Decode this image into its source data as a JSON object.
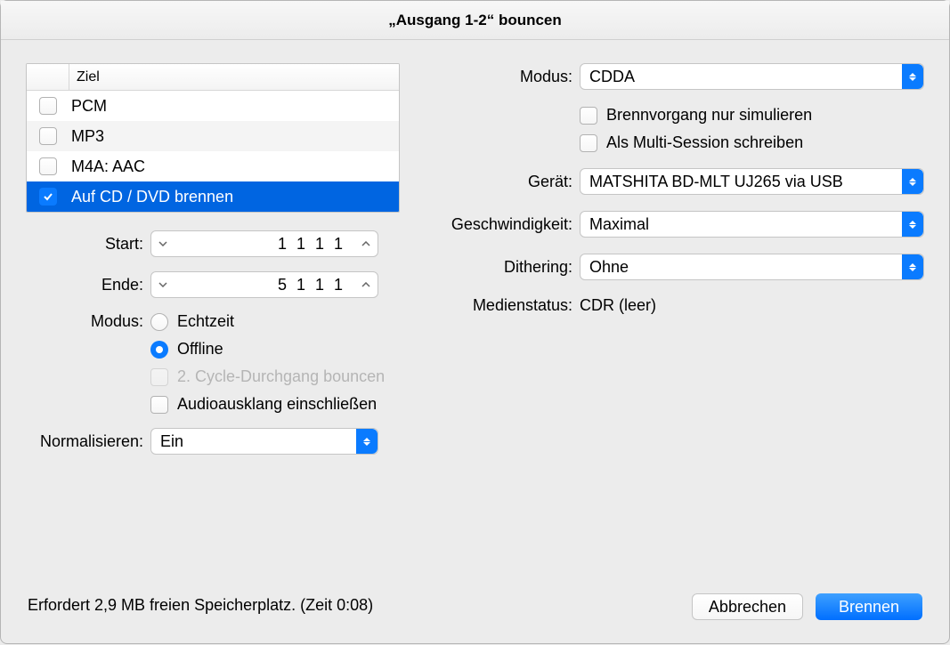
{
  "window": {
    "title": "„Ausgang 1-2“ bouncen"
  },
  "dest_table": {
    "header": "Ziel",
    "rows": [
      {
        "label": "PCM",
        "checked": false
      },
      {
        "label": "MP3",
        "checked": false
      },
      {
        "label": "M4A: AAC",
        "checked": false
      },
      {
        "label": "Auf CD / DVD brennen",
        "checked": true
      }
    ]
  },
  "range": {
    "start_label": "Start:",
    "start_value": "1 1 1   1",
    "end_label": "Ende:",
    "end_value": "5 1 1   1"
  },
  "mode_left": {
    "label": "Modus:",
    "realtime": "Echtzeit",
    "offline": "Offline",
    "second_pass": "2. Cycle-Durchgang bouncen",
    "include_tail": "Audioausklang einschließen"
  },
  "normalize": {
    "label": "Normalisieren:",
    "value": "Ein"
  },
  "right": {
    "mode_label": "Modus:",
    "mode_value": "CDDA",
    "simulate": "Brennvorgang nur simulieren",
    "multi_session": "Als Multi-Session schreiben",
    "device_label": "Gerät:",
    "device_value": "MATSHITA BD-MLT UJ265 via USB",
    "speed_label": "Geschwindigkeit:",
    "speed_value": "Maximal",
    "dither_label": "Dithering:",
    "dither_value": "Ohne",
    "media_label": "Medienstatus:",
    "media_value": "CDR (leer)"
  },
  "footer": {
    "status": "Erfordert 2,9 MB freien Speicherplatz. (Zeit 0:08)",
    "cancel": "Abbrechen",
    "confirm": "Brennen"
  }
}
